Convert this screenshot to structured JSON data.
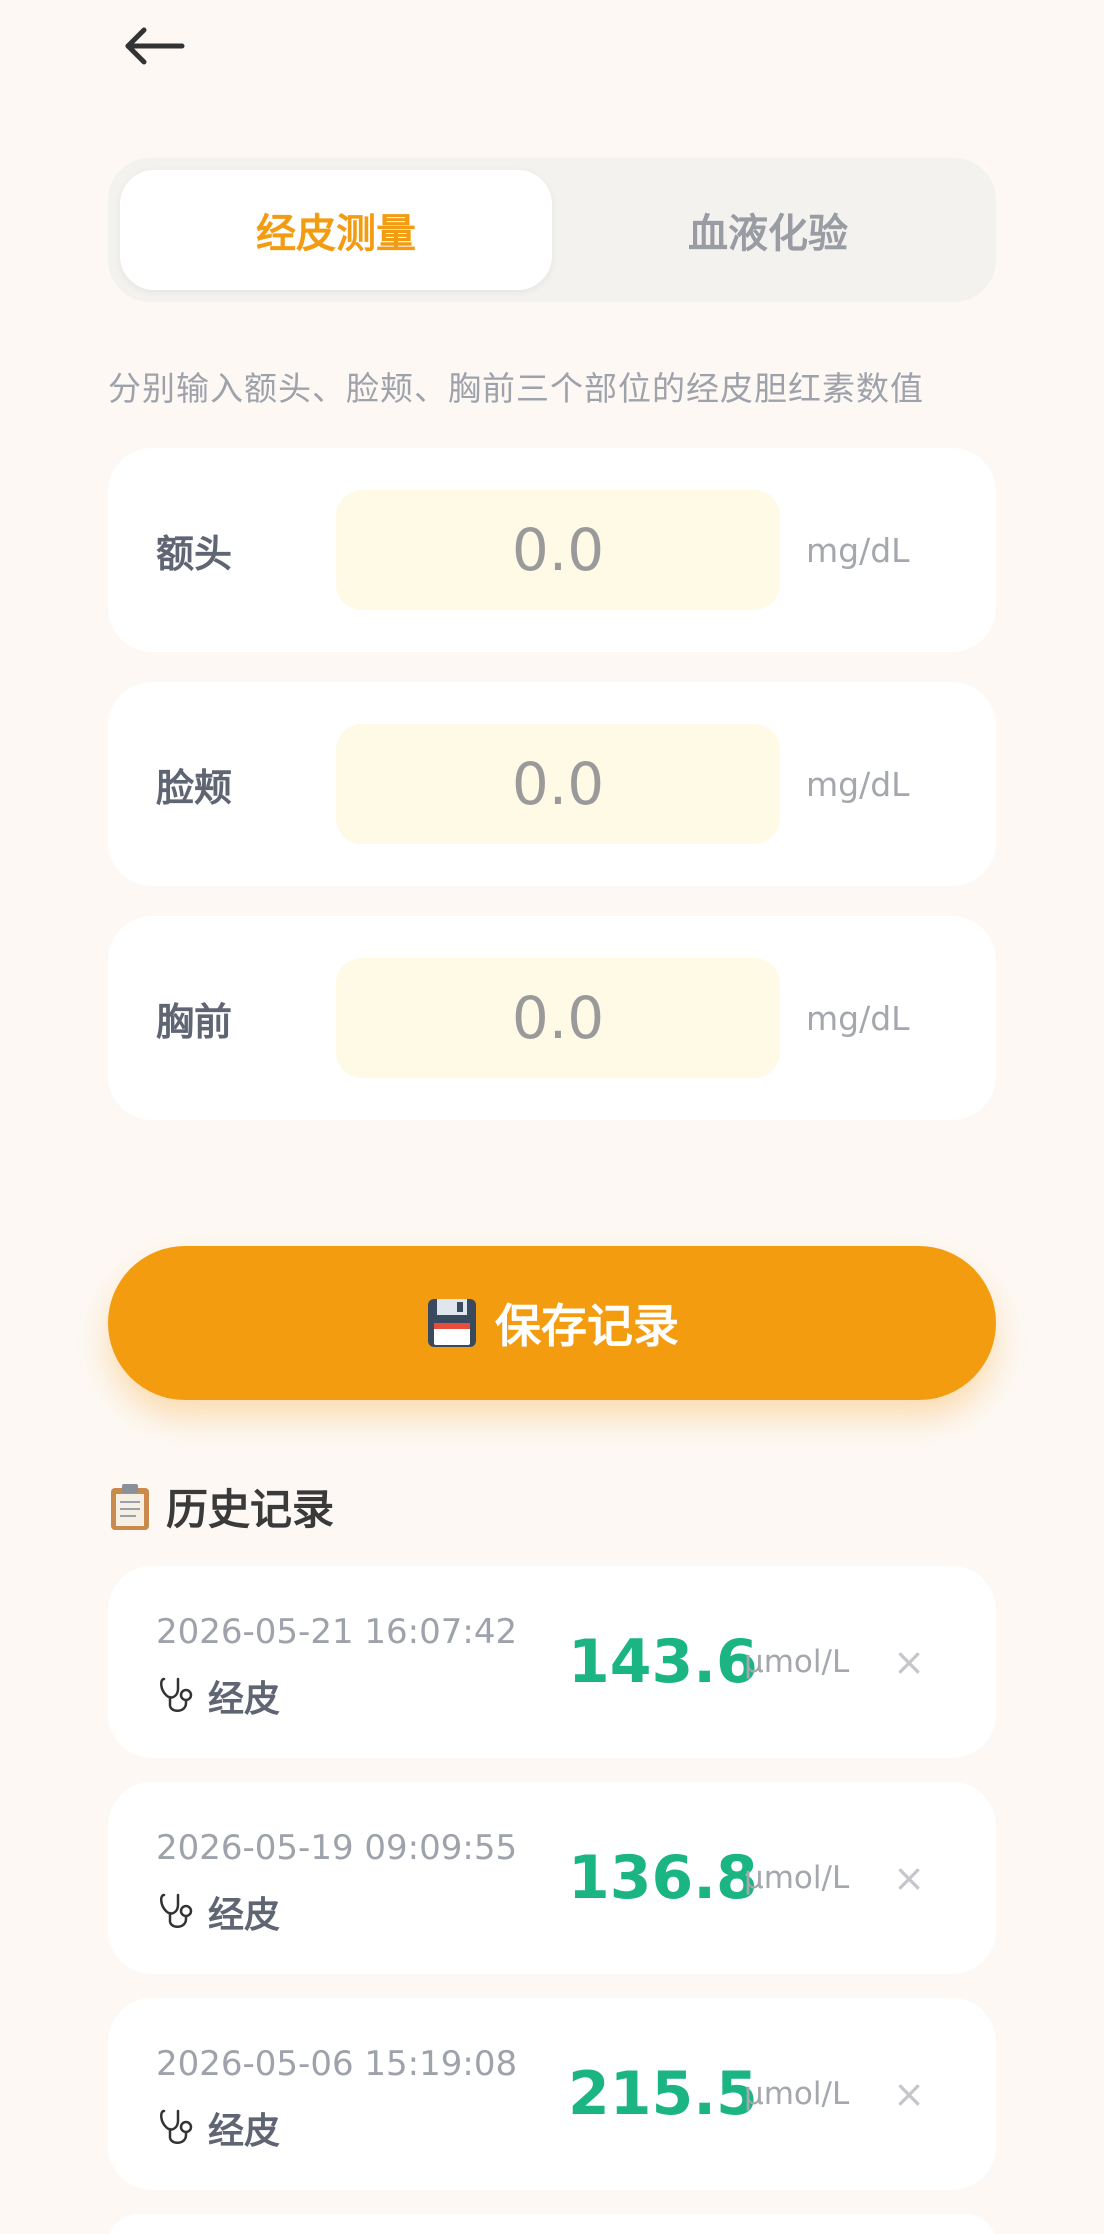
{
  "header": {
    "back_icon": "arrow-left-icon"
  },
  "tabs": [
    {
      "label": "经皮测量",
      "active": true
    },
    {
      "label": "血液化验",
      "active": false
    }
  ],
  "hint": "分别输入额头、脸颊、胸前三个部位的经皮胆红素数值",
  "fields": [
    {
      "label": "额头",
      "placeholder": "0.0",
      "unit": "mg/dL"
    },
    {
      "label": "脸颊",
      "placeholder": "0.0",
      "unit": "mg/dL"
    },
    {
      "label": "胸前",
      "placeholder": "0.0",
      "unit": "mg/dL"
    }
  ],
  "save_button": {
    "icon": "floppy-disk-icon",
    "label": "保存记录"
  },
  "history": {
    "icon": "clipboard-icon",
    "title": "历史记录",
    "records": [
      {
        "date": "2026-05-21 16:07:42",
        "type": "经皮",
        "type_icon": "stethoscope-icon",
        "value": "143.6",
        "unit": "μmol/L",
        "delete": "×"
      },
      {
        "date": "2026-05-19 09:09:55",
        "type": "经皮",
        "type_icon": "stethoscope-icon",
        "value": "136.8",
        "unit": "μmol/L",
        "delete": "×"
      },
      {
        "date": "2026-05-06 15:19:08",
        "type": "经皮",
        "type_icon": "stethoscope-icon",
        "value": "215.5",
        "unit": "μmol/L",
        "delete": "×"
      }
    ]
  },
  "colors": {
    "background": "#fdf8f3",
    "accent": "#f39c0f",
    "value_green": "#1bb483",
    "input_bg": "#fefae6"
  }
}
